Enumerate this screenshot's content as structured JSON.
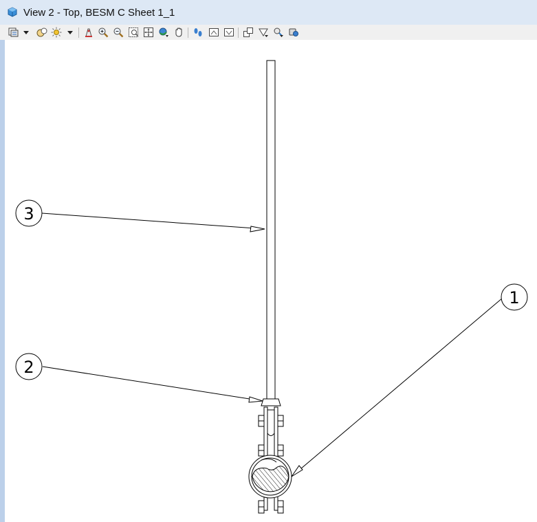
{
  "window": {
    "title": "View 2 - Top, BESM C Sheet 1_1",
    "icon": "view-cube-icon"
  },
  "toolbar": {
    "buttons": [
      {
        "icon": "view-attributes-icon"
      },
      {
        "icon": "dropdown-arrow-icon"
      },
      {
        "icon": "display-style-icon"
      },
      {
        "icon": "lights-icon"
      },
      {
        "icon": "dropdown-arrow-icon"
      },
      {
        "icon": "update-view-icon"
      },
      {
        "icon": "zoom-in-icon"
      },
      {
        "icon": "zoom-out-icon"
      },
      {
        "icon": "window-area-icon"
      },
      {
        "icon": "fit-view-icon"
      },
      {
        "icon": "rotate-view-icon"
      },
      {
        "icon": "pan-view-icon"
      },
      {
        "icon": "walk-icon"
      },
      {
        "icon": "view-previous-icon"
      },
      {
        "icon": "view-next-icon"
      },
      {
        "icon": "copy-view-icon"
      },
      {
        "icon": "clip-volume-icon"
      },
      {
        "icon": "clip-mask-icon"
      },
      {
        "icon": "camera-settings-icon"
      }
    ]
  },
  "drawing": {
    "line_color": "#000000",
    "background": "#ffffff",
    "callouts": [
      {
        "label": "3"
      },
      {
        "label": "2"
      },
      {
        "label": "1"
      }
    ]
  }
}
